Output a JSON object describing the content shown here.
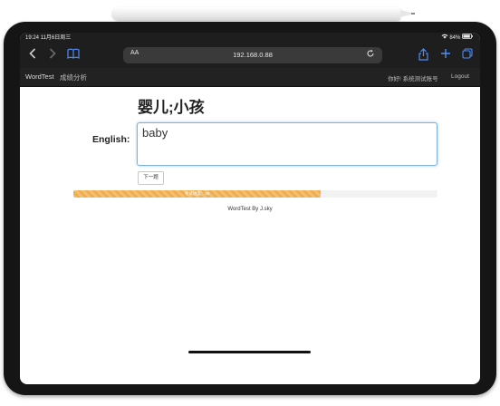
{
  "status": {
    "time": "19:24",
    "date": "11月6日周三",
    "battery": "84%"
  },
  "safari": {
    "aa": "AA",
    "url": "192.168.0.88"
  },
  "nav": {
    "brand": "WordTest",
    "link1": "成绩分析",
    "greeting": "你好! 系统测试账号",
    "logout": "Logout"
  },
  "quiz": {
    "word": "婴儿;小孩",
    "label": "English:",
    "answer": "baby",
    "next": "下一题"
  },
  "progress": {
    "label": "考试进度：68",
    "value_percent": 68,
    "color": "#f0ad4e"
  },
  "footer": {
    "text": "WordTest By J.sky"
  }
}
